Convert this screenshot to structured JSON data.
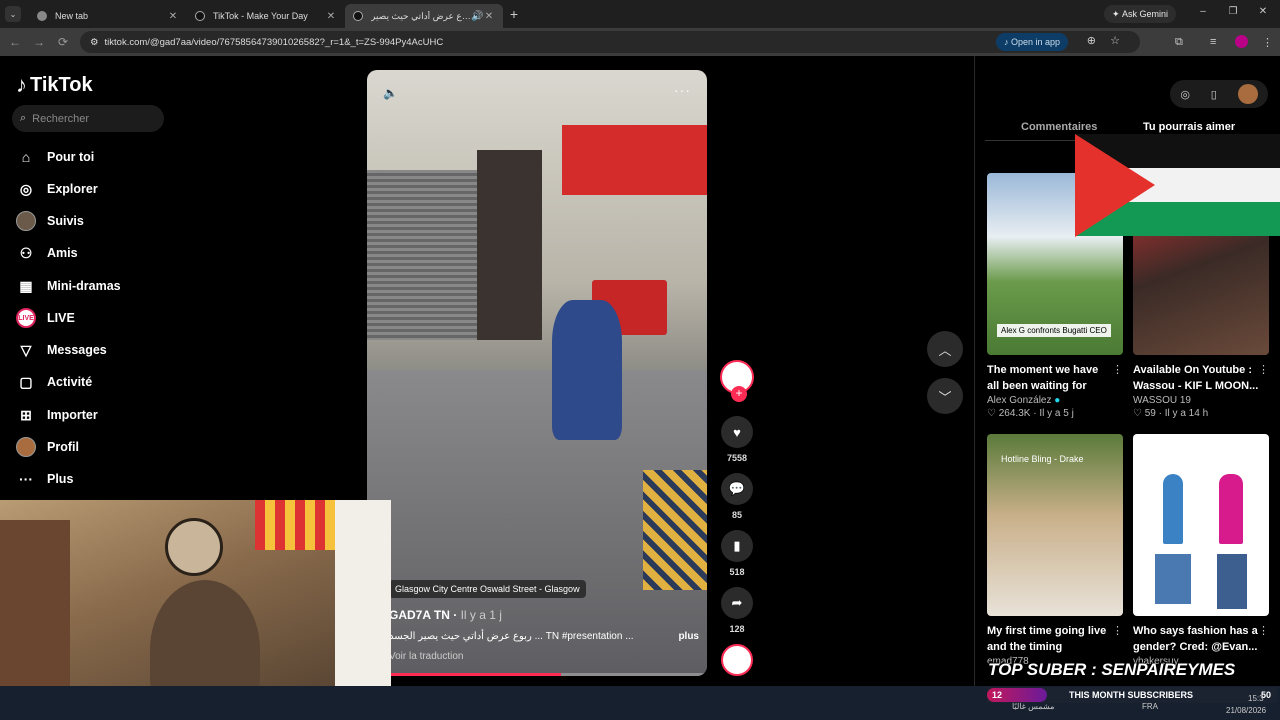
{
  "browser": {
    "tabs": [
      {
        "title": "New tab",
        "active": false
      },
      {
        "title": "TikTok - Make Your Day",
        "active": false
      },
      {
        "title": "ربوع عرض أداتي حيث يصير",
        "active": true
      }
    ],
    "ask_gemini": "Ask Gemini",
    "url": "tiktok.com/@gad7aa/video/7675856473901026582?_r=1&_t=ZS-994Py4AcUHC",
    "open_in_app": "Open in app"
  },
  "sidebar": {
    "logo": "TikTok",
    "search_placeholder": "Rechercher",
    "items": [
      {
        "label": "Pour toi",
        "icon": "home-icon"
      },
      {
        "label": "Explorer",
        "icon": "compass-icon"
      },
      {
        "label": "Suivis",
        "icon": "avatar"
      },
      {
        "label": "Amis",
        "icon": "friends-icon"
      },
      {
        "label": "Mini-dramas",
        "icon": "film-icon"
      },
      {
        "label": "LIVE",
        "icon": "live-icon"
      },
      {
        "label": "Messages",
        "icon": "message-icon"
      },
      {
        "label": "Activité",
        "icon": "activity-icon"
      },
      {
        "label": "Importer",
        "icon": "upload-icon"
      },
      {
        "label": "Profil",
        "icon": "avatar"
      },
      {
        "label": "Plus",
        "icon": "more-icon"
      }
    ]
  },
  "video": {
    "location": "Glasgow City Centre Oswald Street - Glasgow",
    "username": "GAD7A TN",
    "posted": "Il y a 1 j",
    "caption": "ربوع عرض أداتي حيث يصير الجسد ... TN #presentation ...",
    "more": "plus",
    "translate": "Voir la traduction",
    "progress": 0.57,
    "likes": "7558",
    "comments": "85",
    "saves": "518",
    "shares": "128"
  },
  "right_panel": {
    "tab_comments": "Commentaires",
    "tab_related": "Tu pourrais aimer",
    "cards": [
      {
        "thumb_caption": "Alex G confronts Bugatti CEO",
        "title": "The moment we have all been waiting for",
        "author": "Alex González",
        "likes": "264.3K",
        "age": "Il y a 5 j"
      },
      {
        "thumb_caption": "",
        "title": "Available On Youtube : Wassou - KIF L MOON...",
        "author": "WASSOU 19",
        "likes": "59",
        "age": "Il y a 14 h"
      },
      {
        "thumb_caption": "Hotline Bling - Drake",
        "title": "My first time going live and the timing couldn'...",
        "author": "emad778",
        "likes": "",
        "age": ""
      },
      {
        "thumb_caption": "",
        "title": "Who says fashion has a gender? Cred: @Evan...",
        "author": "yhakersuy",
        "likes": "",
        "age": ""
      }
    ]
  },
  "stream_overlay": {
    "banner": "TOP SUBER : SENPAIREYMES",
    "subs_count": "12",
    "subs_label": "THIS MONTH SUBSCRIBERS",
    "subs_goal": "50"
  },
  "taskbar": {
    "lang": "FRA",
    "time": "15:3",
    "date": "21/08/2026",
    "arabic_text": "مشمس غالبًا"
  }
}
